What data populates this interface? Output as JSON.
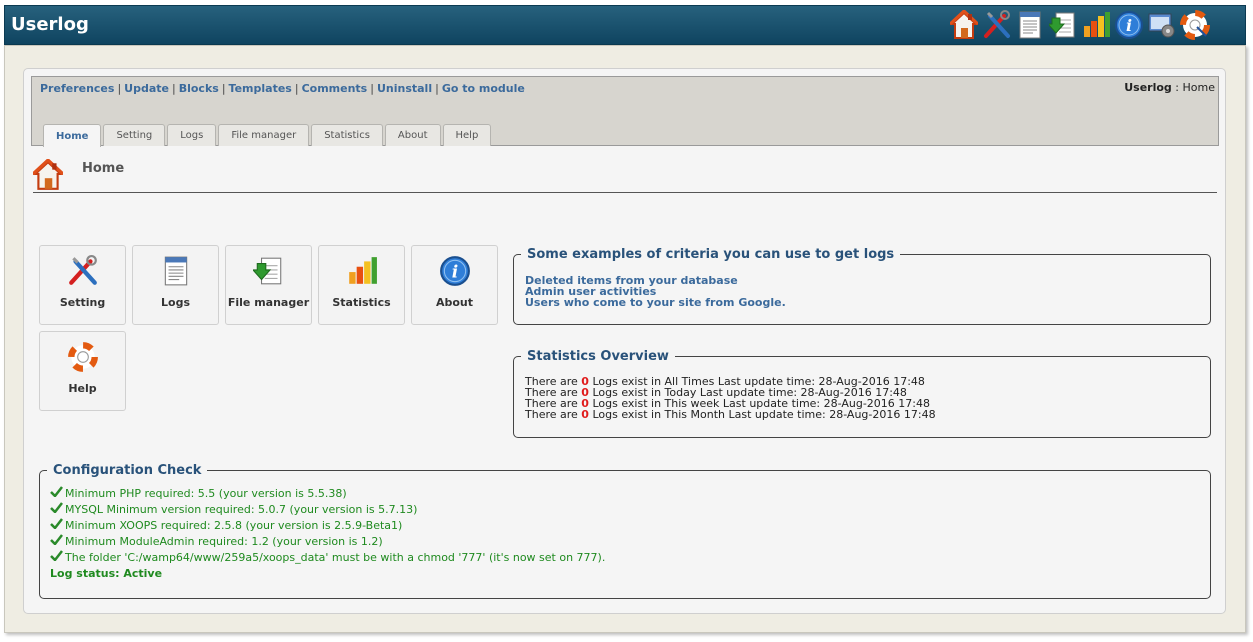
{
  "app": {
    "title": "Userlog"
  },
  "top_icons": [
    "home-icon",
    "tools-icon",
    "document-icon",
    "file-manager-icon",
    "statistics-icon",
    "info-icon",
    "settings-window-icon",
    "help-lifebuoy-icon"
  ],
  "admin_links": [
    "Preferences",
    "Update",
    "Blocks",
    "Templates",
    "Comments",
    "Uninstall",
    "Go to module"
  ],
  "breadcrumb": {
    "module": "Userlog",
    "separator": ":",
    "page": "Home"
  },
  "tabs": [
    "Home",
    "Setting",
    "Logs",
    "File manager",
    "Statistics",
    "About",
    "Help"
  ],
  "active_tab": "Home",
  "page_title": "Home",
  "menu_buttons": [
    {
      "label": "Setting",
      "icon": "tools-icon"
    },
    {
      "label": "Logs",
      "icon": "document-icon"
    },
    {
      "label": "File manager",
      "icon": "file-manager-icon"
    },
    {
      "label": "Statistics",
      "icon": "statistics-icon"
    },
    {
      "label": "About",
      "icon": "info-icon"
    },
    {
      "label": "Help",
      "icon": "help-lifebuoy-icon"
    }
  ],
  "criteria": {
    "legend": "Some examples of criteria you can use to get logs",
    "items": [
      "Deleted items from your database",
      "Admin user activities",
      "Users who come to your site from Google."
    ]
  },
  "stats": {
    "legend": "Statistics Overview",
    "prefix": "There are",
    "rows": [
      {
        "count": "0",
        "text": "Logs exist in All Times Last update time: 28-Aug-2016 17:48"
      },
      {
        "count": "0",
        "text": "Logs exist in Today Last update time: 28-Aug-2016 17:48"
      },
      {
        "count": "0",
        "text": "Logs exist in This week Last update time: 28-Aug-2016 17:48"
      },
      {
        "count": "0",
        "text": "Logs exist in This Month Last update time: 28-Aug-2016 17:48"
      }
    ]
  },
  "config": {
    "legend": "Configuration Check",
    "checks": [
      "Minimum PHP required: 5.5 (your version is 5.5.38)",
      "MYSQL Minimum version required: 5.0.7 (your version is 5.7.13)",
      "Minimum XOOPS required: 2.5.8 (your version is 2.5.9-Beta1)",
      "Minimum ModuleAdmin required: 1.2 (your version is 1.2)",
      "The folder 'C:/wamp64/www/259a5/xoops_data' must be with a chmod '777' (it's now set on 777)."
    ],
    "log_status": "Log status: Active"
  },
  "colors": {
    "title_bar": "#1b5572",
    "link": "#3b6a9c",
    "legend": "#29527a",
    "ok": "#1f8a1f",
    "zero": "#e01b1b"
  }
}
